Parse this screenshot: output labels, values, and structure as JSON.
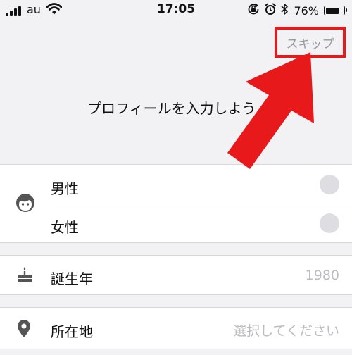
{
  "status_bar": {
    "carrier": "au",
    "time": "17:05",
    "battery_percent": "76%",
    "battery_level": 0.76,
    "icons": [
      "signal-icon",
      "wifi-icon",
      "screen-lock-icon",
      "alarm-icon",
      "bluetooth-icon",
      "battery-icon"
    ]
  },
  "header": {
    "skip_label": "スキップ",
    "heading": "プロフィールを入力しよう"
  },
  "annotation": {
    "color": "#e8191b"
  },
  "gender": {
    "icon": "face-icon",
    "options": [
      {
        "label": "男性"
      },
      {
        "label": "女性"
      }
    ]
  },
  "birth_year": {
    "icon": "birthday-cake-icon",
    "label": "誕生年",
    "value": "1980"
  },
  "location": {
    "icon": "location-pin-icon",
    "label": "所在地",
    "placeholder": "選択してください"
  }
}
